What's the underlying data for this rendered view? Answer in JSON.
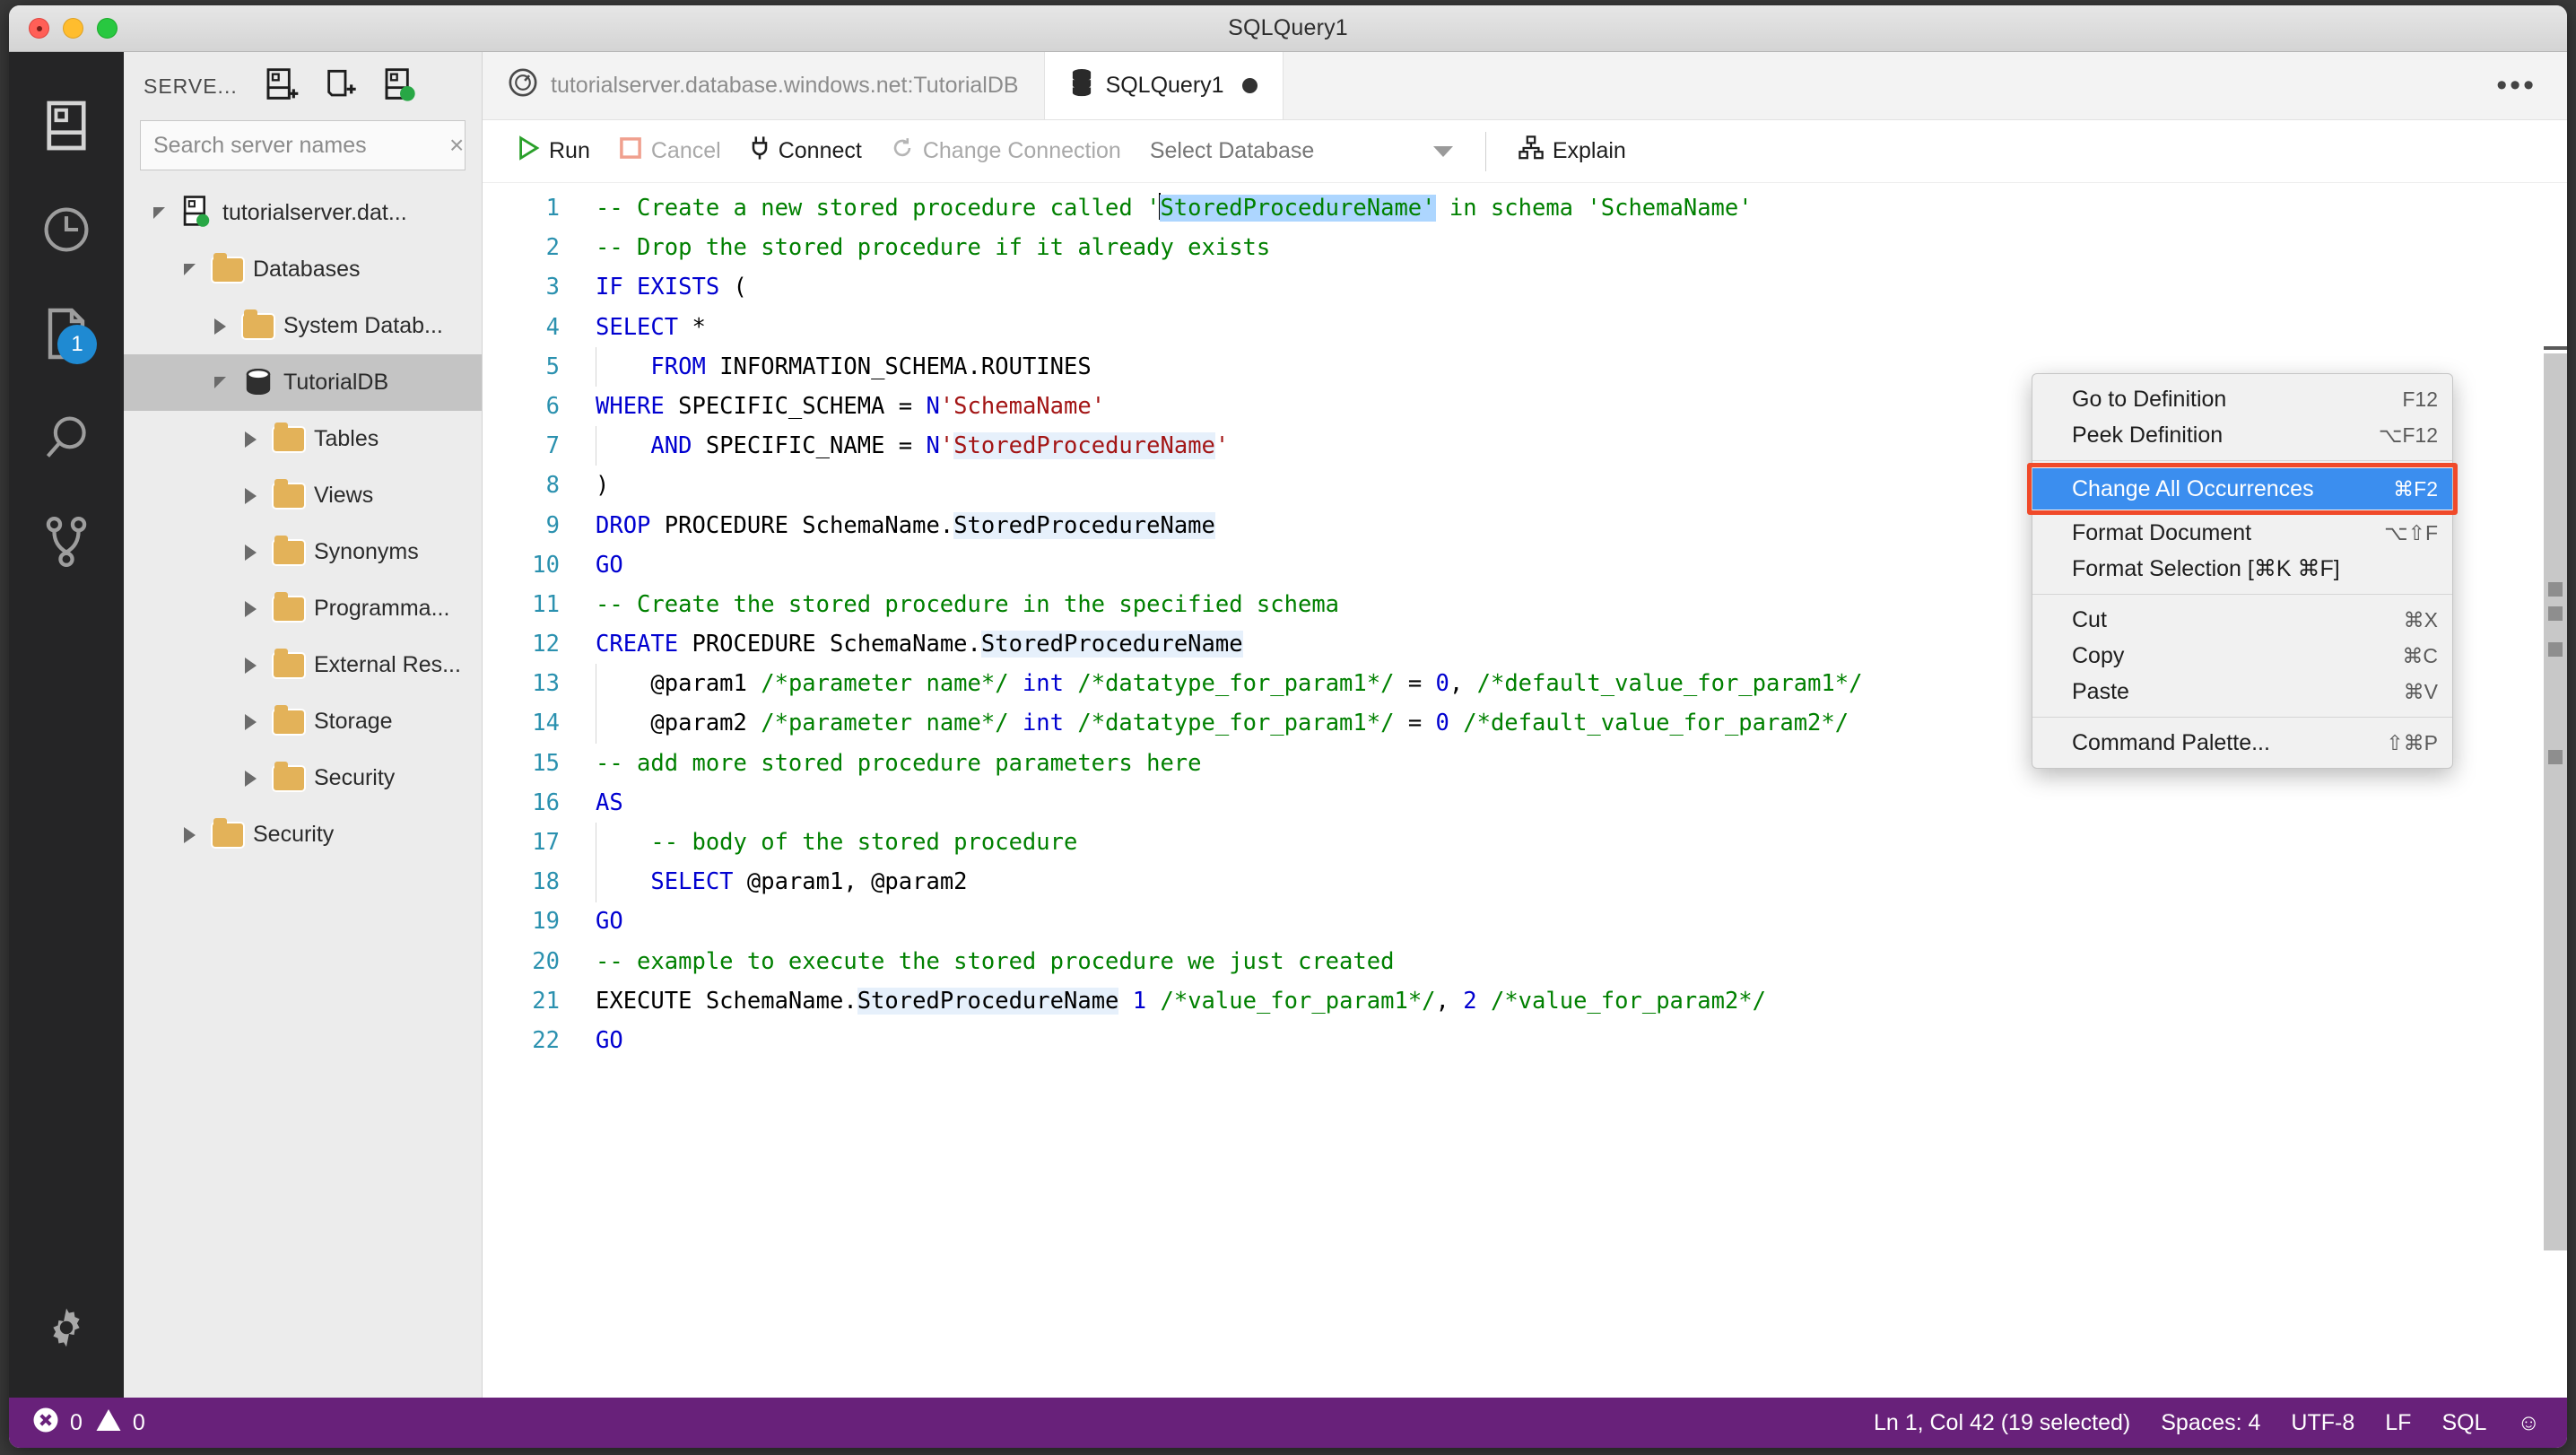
{
  "window": {
    "title": "SQLQuery1",
    "traffic_lights": [
      "close",
      "minimize",
      "zoom"
    ]
  },
  "activity_bar": {
    "items": [
      {
        "name": "servers-icon",
        "label": "Servers"
      },
      {
        "name": "history-icon",
        "label": "History"
      },
      {
        "name": "notebook-icon",
        "label": "Notebooks",
        "badge": "1"
      },
      {
        "name": "search-icon",
        "label": "Search"
      },
      {
        "name": "source-control-icon",
        "label": "Source Control"
      }
    ],
    "bottom": {
      "name": "gear-icon",
      "label": "Manage"
    }
  },
  "sidebar": {
    "title": "SERVE...",
    "actions": [
      {
        "name": "new-connection-icon",
        "label": "New Connection"
      },
      {
        "name": "new-server-group-icon",
        "label": "New Server Group"
      },
      {
        "name": "active-connections-icon",
        "label": "Show Active Connections"
      }
    ],
    "search": {
      "placeholder": "Search server names",
      "value": "",
      "clear": "×"
    },
    "tree": [
      {
        "label": "tutorialserver.dat...",
        "indent": 0,
        "twisty": "down",
        "icon": "server-icon",
        "selected": false
      },
      {
        "label": "Databases",
        "indent": 1,
        "twisty": "down",
        "icon": "folder-icon",
        "selected": false
      },
      {
        "label": "System Datab...",
        "indent": 2,
        "twisty": "right",
        "icon": "folder-icon",
        "selected": false
      },
      {
        "label": "TutorialDB",
        "indent": 2,
        "twisty": "down",
        "icon": "database-icon",
        "selected": true
      },
      {
        "label": "Tables",
        "indent": 3,
        "twisty": "right",
        "icon": "folder-icon",
        "selected": false
      },
      {
        "label": "Views",
        "indent": 3,
        "twisty": "right",
        "icon": "folder-icon",
        "selected": false
      },
      {
        "label": "Synonyms",
        "indent": 3,
        "twisty": "right",
        "icon": "folder-icon",
        "selected": false
      },
      {
        "label": "Programma...",
        "indent": 3,
        "twisty": "right",
        "icon": "folder-icon",
        "selected": false
      },
      {
        "label": "External Res...",
        "indent": 3,
        "twisty": "right",
        "icon": "folder-icon",
        "selected": false
      },
      {
        "label": "Storage",
        "indent": 3,
        "twisty": "right",
        "icon": "folder-icon",
        "selected": false
      },
      {
        "label": "Security",
        "indent": 3,
        "twisty": "right",
        "icon": "folder-icon",
        "selected": false
      },
      {
        "label": "Security",
        "indent": 1,
        "twisty": "right",
        "icon": "folder-icon",
        "selected": false
      }
    ]
  },
  "tabs": [
    {
      "label": "tutorialserver.database.windows.net:TutorialDB",
      "icon": "dashboard-icon",
      "active": false,
      "dirty": false
    },
    {
      "label": "SQLQuery1",
      "icon": "query-icon",
      "active": true,
      "dirty": true
    }
  ],
  "tabbar_more": "•••",
  "toolbar": {
    "run": "Run",
    "cancel": "Cancel",
    "connect": "Connect",
    "change_connection": "Change Connection",
    "select_database": "Select Database",
    "explain": "Explain"
  },
  "editor": {
    "lines": [
      {
        "n": 1,
        "segments": [
          {
            "t": "-- Create a new stored procedure called ",
            "c": "cm"
          },
          {
            "t": "'",
            "c": "cm"
          },
          {
            "t": "cursor",
            "c": "cursor"
          },
          {
            "t": "StoredProcedureName",
            "c": "cm selhl"
          },
          {
            "t": "'",
            "c": "cm selhl"
          },
          {
            "t": " in schema 'SchemaName'",
            "c": "cm"
          }
        ]
      },
      {
        "n": 2,
        "segments": [
          {
            "t": "-- Drop the stored procedure if it already exists",
            "c": "cm"
          }
        ]
      },
      {
        "n": 3,
        "segments": [
          {
            "t": "IF EXISTS",
            "c": "kw"
          },
          {
            "t": " (",
            "c": ""
          }
        ]
      },
      {
        "n": 4,
        "segments": [
          {
            "t": "SELECT",
            "c": "kw"
          },
          {
            "t": " *",
            "c": ""
          }
        ]
      },
      {
        "n": 5,
        "segments": [
          {
            "t": "    ",
            "c": ""
          },
          {
            "t": "FROM",
            "c": "kw"
          },
          {
            "t": " INFORMATION_SCHEMA.ROUTINES",
            "c": ""
          }
        ]
      },
      {
        "n": 6,
        "segments": [
          {
            "t": "WHERE",
            "c": "kw"
          },
          {
            "t": " SPECIFIC_SCHEMA = ",
            "c": ""
          },
          {
            "t": "N",
            "c": "kw"
          },
          {
            "t": "'SchemaName'",
            "c": "str"
          }
        ]
      },
      {
        "n": 7,
        "segments": [
          {
            "t": "    ",
            "c": ""
          },
          {
            "t": "AND",
            "c": "kw"
          },
          {
            "t": " SPECIFIC_NAME = ",
            "c": ""
          },
          {
            "t": "N",
            "c": "kw"
          },
          {
            "t": "'",
            "c": "str"
          },
          {
            "t": "StoredProcedureName",
            "c": "str hl"
          },
          {
            "t": "'",
            "c": "str"
          }
        ]
      },
      {
        "n": 8,
        "segments": [
          {
            "t": ")",
            "c": ""
          }
        ]
      },
      {
        "n": 9,
        "segments": [
          {
            "t": "DROP",
            "c": "kw"
          },
          {
            "t": " PROCEDURE SchemaName.",
            "c": ""
          },
          {
            "t": "StoredProcedureName",
            "c": "hl"
          }
        ]
      },
      {
        "n": 10,
        "segments": [
          {
            "t": "GO",
            "c": "kw"
          }
        ]
      },
      {
        "n": 11,
        "segments": [
          {
            "t": "-- Create the stored procedure in the specified schema",
            "c": "cm"
          }
        ]
      },
      {
        "n": 12,
        "segments": [
          {
            "t": "CREATE",
            "c": "kw"
          },
          {
            "t": " PROCEDURE SchemaName.",
            "c": ""
          },
          {
            "t": "StoredProcedureName",
            "c": "hl"
          }
        ]
      },
      {
        "n": 13,
        "segments": [
          {
            "t": "    @param1 ",
            "c": ""
          },
          {
            "t": "/*parameter name*/",
            "c": "cm"
          },
          {
            "t": " ",
            "c": ""
          },
          {
            "t": "int",
            "c": "kw"
          },
          {
            "t": " ",
            "c": ""
          },
          {
            "t": "/*datatype_for_param1*/",
            "c": "cm"
          },
          {
            "t": " = ",
            "c": ""
          },
          {
            "t": "0",
            "c": "num"
          },
          {
            "t": ", ",
            "c": ""
          },
          {
            "t": "/*default_value_for_param1*/",
            "c": "cm"
          }
        ]
      },
      {
        "n": 14,
        "segments": [
          {
            "t": "    @param2 ",
            "c": ""
          },
          {
            "t": "/*parameter name*/",
            "c": "cm"
          },
          {
            "t": " ",
            "c": ""
          },
          {
            "t": "int",
            "c": "kw"
          },
          {
            "t": " ",
            "c": ""
          },
          {
            "t": "/*datatype_for_param1*/",
            "c": "cm"
          },
          {
            "t": " = ",
            "c": ""
          },
          {
            "t": "0",
            "c": "num"
          },
          {
            "t": " ",
            "c": ""
          },
          {
            "t": "/*default_value_for_param2*/",
            "c": "cm"
          }
        ]
      },
      {
        "n": 15,
        "segments": [
          {
            "t": "-- add more stored procedure parameters here",
            "c": "cm"
          }
        ]
      },
      {
        "n": 16,
        "segments": [
          {
            "t": "AS",
            "c": "kw"
          }
        ]
      },
      {
        "n": 17,
        "segments": [
          {
            "t": "    ",
            "c": ""
          },
          {
            "t": "-- body of the stored procedure",
            "c": "cm"
          }
        ]
      },
      {
        "n": 18,
        "segments": [
          {
            "t": "    ",
            "c": ""
          },
          {
            "t": "SELECT",
            "c": "kw"
          },
          {
            "t": " @param1, @param2",
            "c": ""
          }
        ]
      },
      {
        "n": 19,
        "segments": [
          {
            "t": "GO",
            "c": "kw"
          }
        ]
      },
      {
        "n": 20,
        "segments": [
          {
            "t": "-- example to execute the stored procedure we just created",
            "c": "cm"
          }
        ]
      },
      {
        "n": 21,
        "segments": [
          {
            "t": "EXECUTE SchemaName.",
            "c": ""
          },
          {
            "t": "StoredProcedureName",
            "c": "hl"
          },
          {
            "t": " ",
            "c": ""
          },
          {
            "t": "1",
            "c": "num"
          },
          {
            "t": " ",
            "c": ""
          },
          {
            "t": "/*value_for_param1*/",
            "c": "cm"
          },
          {
            "t": ", ",
            "c": ""
          },
          {
            "t": "2",
            "c": "num"
          },
          {
            "t": " ",
            "c": ""
          },
          {
            "t": "/*value_for_param2*/",
            "c": "cm"
          }
        ]
      },
      {
        "n": 22,
        "segments": [
          {
            "t": "GO",
            "c": "kw"
          }
        ]
      }
    ]
  },
  "context_menu": {
    "groups": [
      [
        {
          "label": "Go to Definition",
          "accel": "F12",
          "highlighted": false
        },
        {
          "label": "Peek Definition",
          "accel": "⌥F12",
          "highlighted": false
        }
      ],
      [
        {
          "label": "Change All Occurrences",
          "accel": "⌘F2",
          "highlighted": true
        },
        {
          "label": "Format Document",
          "accel": "⌥⇧F",
          "highlighted": false
        },
        {
          "label": "Format Selection [⌘K ⌘F]",
          "accel": "",
          "highlighted": false
        }
      ],
      [
        {
          "label": "Cut",
          "accel": "⌘X",
          "highlighted": false
        },
        {
          "label": "Copy",
          "accel": "⌘C",
          "highlighted": false
        },
        {
          "label": "Paste",
          "accel": "⌘V",
          "highlighted": false
        }
      ],
      [
        {
          "label": "Command Palette...",
          "accel": "⇧⌘P",
          "highlighted": false
        }
      ]
    ]
  },
  "status_bar": {
    "errors": "0",
    "warnings": "0",
    "cursor": "Ln 1, Col 42 (19 selected)",
    "indent": "Spaces: 4",
    "encoding": "UTF-8",
    "eol": "LF",
    "language": "SQL",
    "feedback": "☺"
  },
  "colors": {
    "status_bar": "#68217a",
    "accent_selection": "#3b8eef",
    "highlight_outline": "#f04a2a",
    "keyword": "#0000d0",
    "comment": "#008000",
    "string": "#a31515",
    "line_number": "#2b91af",
    "folder": "#e3b259",
    "connected_dot": "#28a745"
  }
}
